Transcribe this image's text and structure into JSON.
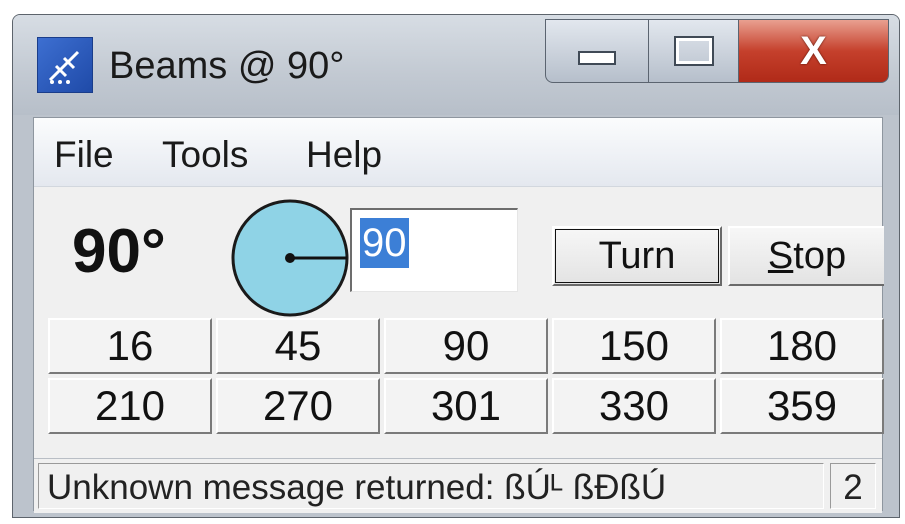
{
  "window": {
    "title": "Beams @ 90°",
    "close_glyph": "X"
  },
  "menu": {
    "items": [
      "File",
      "Tools",
      "Help"
    ]
  },
  "controls": {
    "current_angle": "90°",
    "heading_value": "90",
    "turn_label": "Turn",
    "stop_label_first": "S",
    "stop_label_rest": "top",
    "compass_heading_deg": 90
  },
  "presets": [
    "16",
    "45",
    "90",
    "150",
    "180",
    "210",
    "270",
    "301",
    "330",
    "359"
  ],
  "status": {
    "message": "Unknown message returned: ßÚᴸ     ßÐßÚ",
    "count": "2"
  },
  "colors": {
    "compass_fill": "#8fd3e6",
    "selection": "#3c7fd6",
    "close_button": "#c5402c"
  },
  "icons": {
    "app": "antenna-icon",
    "minimize": "minimize-icon",
    "maximize": "maximize-icon",
    "close": "close-icon"
  }
}
